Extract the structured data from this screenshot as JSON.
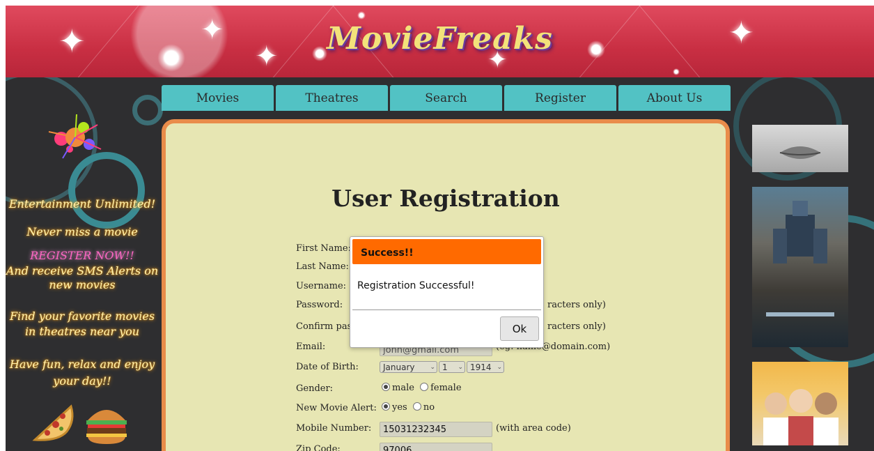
{
  "site": {
    "title": "MovieFreaks"
  },
  "nav": {
    "items": [
      {
        "label": "Movies"
      },
      {
        "label": "Theatres"
      },
      {
        "label": "Search"
      },
      {
        "label": "Register"
      },
      {
        "label": "About Us"
      }
    ]
  },
  "sidebar": {
    "promos": [
      "Entertainment Unlimited!",
      "Never miss a movie",
      "REGISTER NOW!!",
      "And receive SMS Alerts on new movies",
      "Find your favorite movies in theatres near you",
      "Have fun, relax and enjoy your day!!"
    ]
  },
  "form": {
    "heading": "User Registration",
    "labels": {
      "first_name": "First Name:",
      "last_name": "Last Name:",
      "username": "Username:",
      "password": "Password:",
      "confirm_password": "Confirm passw",
      "email": "Email:",
      "dob": "Date of Birth:",
      "gender": "Gender:",
      "alert": "New Movie Alert:",
      "mobile": "Mobile Number:",
      "zip": "Zip Code:"
    },
    "hints": {
      "password": "racters only)",
      "confirm_password": "racters only)",
      "email": "(eg: name@domain.com)",
      "mobile": "(with area code)"
    },
    "values": {
      "email": "john@gmail.com",
      "dob_month": "January",
      "dob_day": "1",
      "dob_year": "1914",
      "mobile": "15031232345",
      "zip": "97006"
    },
    "gender_options": {
      "male": "male",
      "female": "female"
    },
    "alert_options": {
      "yes": "yes",
      "no": "no"
    }
  },
  "dialog": {
    "title": "Success!!",
    "message": "Registration Successful!",
    "ok_label": "Ok"
  },
  "colors": {
    "banner": "#c92f43",
    "nav_tab": "#52c2c4",
    "panel_bg": "#e7e6b3",
    "panel_border": "#e98c4a",
    "dialog_header": "#ff6a00"
  }
}
